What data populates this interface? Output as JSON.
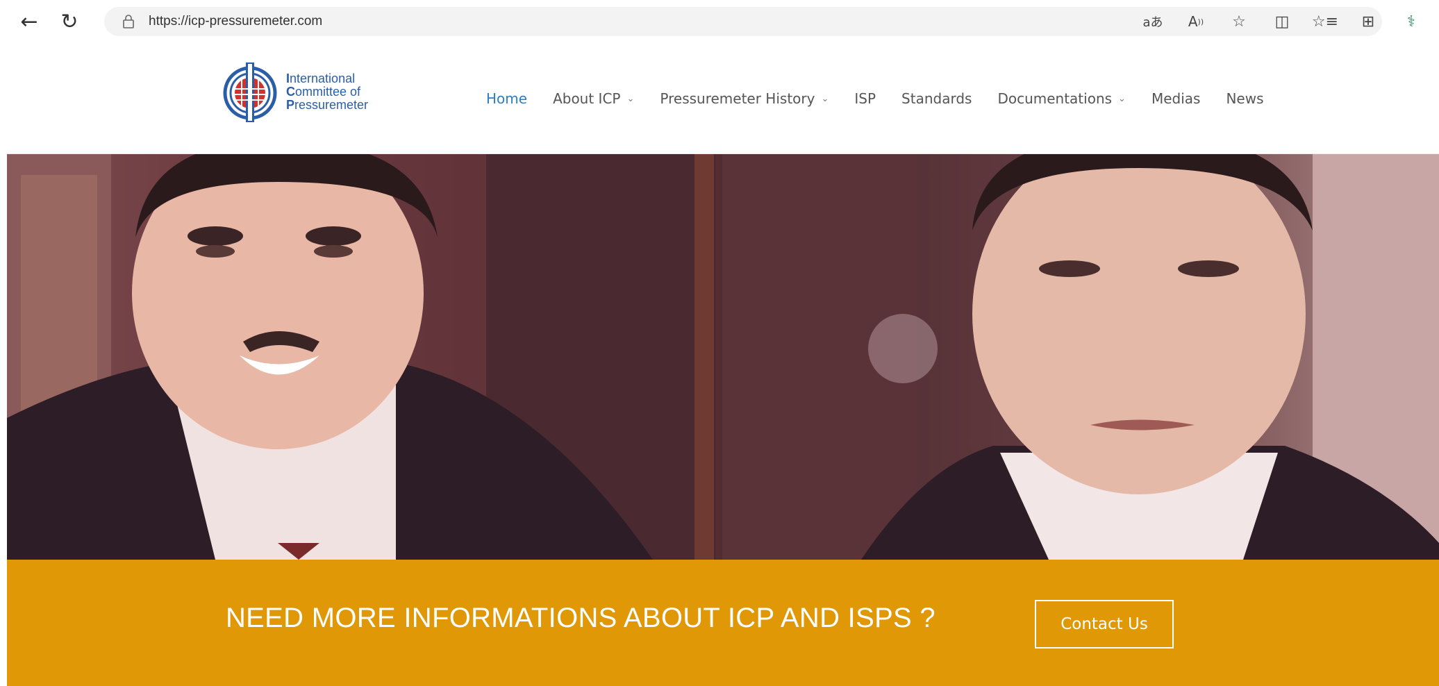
{
  "browser": {
    "url": "https://icp-pressuremeter.com",
    "back_icon": "arrow-left",
    "reload_icon": "reload",
    "toolbar_icons": [
      "translate-icon",
      "read-aloud-icon",
      "favorite-star-icon",
      "split-screen-icon",
      "favorites-icon",
      "collections-icon",
      "extension-icon"
    ]
  },
  "site": {
    "logo": {
      "line1": "International",
      "line2": "Committee of",
      "line3": "Pressuremeter",
      "colors": {
        "blue": "#2a5ea8",
        "red": "#d0322d"
      }
    },
    "nav": [
      {
        "label": "Home",
        "active": true,
        "dropdown": false
      },
      {
        "label": "About ICP",
        "active": false,
        "dropdown": true
      },
      {
        "label": "Pressuremeter History",
        "active": false,
        "dropdown": true
      },
      {
        "label": "ISP",
        "active": false,
        "dropdown": false
      },
      {
        "label": "Standards",
        "active": false,
        "dropdown": false
      },
      {
        "label": "Documentations",
        "active": false,
        "dropdown": true
      },
      {
        "label": "Medias",
        "active": false,
        "dropdown": false
      },
      {
        "label": "News",
        "active": false,
        "dropdown": false
      }
    ],
    "nav_active_color": "#2a7fc4"
  },
  "cta": {
    "text": "NEED MORE INFORMATIONS ABOUT ICP AND ISPS ?",
    "button_label": "Contact Us",
    "background_color": "#e09806"
  }
}
